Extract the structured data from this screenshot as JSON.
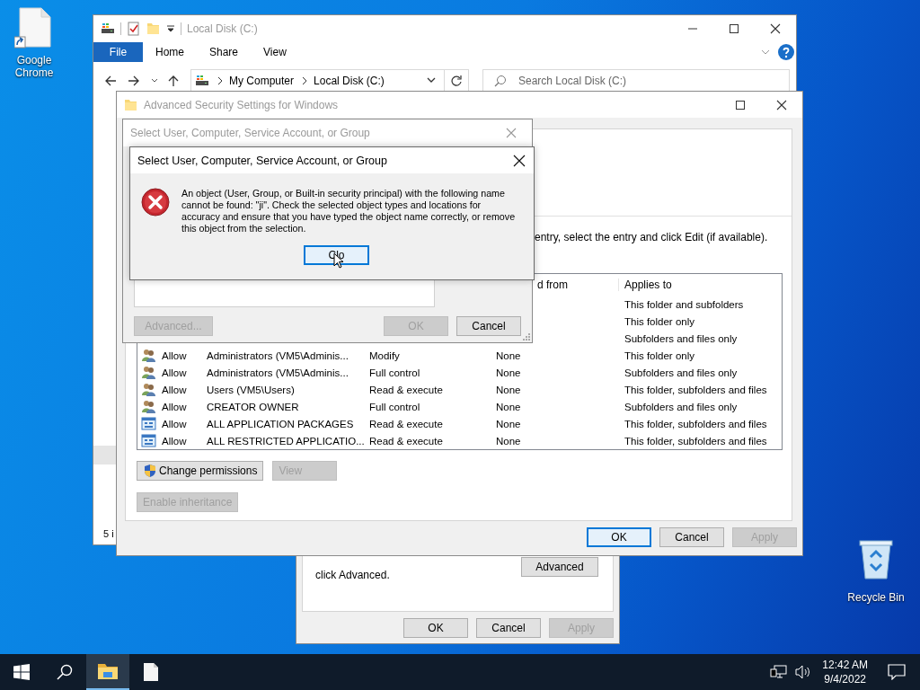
{
  "desktop_icons": [
    {
      "label": "Google Chrome",
      "kind": "shortcut"
    },
    {
      "label": "Recycle Bin",
      "kind": "recycle"
    }
  ],
  "explorer": {
    "title": "Local Disk (C:)",
    "ribbon_tabs": [
      {
        "label": "File",
        "kind": "menu"
      },
      {
        "label": "Home",
        "kind": "tab"
      },
      {
        "label": "Share",
        "kind": "tab"
      },
      {
        "label": "View",
        "kind": "tab"
      }
    ],
    "path": [
      "My Computer",
      "Local Disk (C:)"
    ],
    "search": {
      "placeholder": "Search Local Disk (C:)"
    },
    "status": "5 i"
  },
  "advanced_security": {
    "title": "Advanced Security Settings for Windows",
    "instruction": "entry, select the entry and click Edit (if available).",
    "columns": [
      "d from",
      "Applies to"
    ],
    "rows": [
      {
        "applies_to": "This folder and subfolders"
      },
      {
        "applies_to": "This folder only"
      },
      {
        "applies_to": "Subfolders and files only"
      },
      {
        "kind": "group",
        "type": "Allow",
        "principal": "Administrators (VM5\\Adminis...",
        "access": "Modify",
        "inherited": "None",
        "applies_to": "This folder only"
      },
      {
        "kind": "group",
        "type": "Allow",
        "principal": "Administrators (VM5\\Adminis...",
        "access": "Full control",
        "inherited": "None",
        "applies_to": "Subfolders and files only"
      },
      {
        "kind": "group",
        "type": "Allow",
        "principal": "Users (VM5\\Users)",
        "access": "Read & execute",
        "inherited": "None",
        "applies_to": "This folder, subfolders and files"
      },
      {
        "kind": "group",
        "type": "Allow",
        "principal": "CREATOR OWNER",
        "access": "Full control",
        "inherited": "None",
        "applies_to": "Subfolders and files only"
      },
      {
        "kind": "package",
        "type": "Allow",
        "principal": "ALL APPLICATION PACKAGES",
        "access": "Read & execute",
        "inherited": "None",
        "applies_to": "This folder, subfolders and files"
      },
      {
        "kind": "package",
        "type": "Allow",
        "principal": "ALL RESTRICTED APPLICATIO...",
        "access": "Read & execute",
        "inherited": "None",
        "applies_to": "This folder, subfolders and files"
      }
    ],
    "actions": [
      {
        "label": "Change permissions",
        "shield": true,
        "disabled": false
      },
      {
        "label": "View",
        "shield": false,
        "disabled": true
      }
    ],
    "inheritance_button": {
      "label": "Enable inheritance",
      "disabled": true
    },
    "buttons": [
      {
        "label": "OK",
        "default": true,
        "disabled": false
      },
      {
        "label": "Cancel",
        "default": false,
        "disabled": false
      },
      {
        "label": "Apply",
        "default": false,
        "disabled": true
      }
    ]
  },
  "properties": {
    "note": "click Advanced.",
    "advanced_button": "Advanced",
    "buttons": [
      {
        "label": "OK",
        "default": false,
        "disabled": false
      },
      {
        "label": "Cancel",
        "default": false,
        "disabled": false
      },
      {
        "label": "Apply",
        "default": false,
        "disabled": true
      }
    ]
  },
  "select_dialog": {
    "title": "Select User, Computer, Service Account, or Group",
    "advanced_button": {
      "label": "Advanced...",
      "disabled": true
    },
    "buttons": [
      {
        "label": "OK",
        "default": false,
        "disabled": true
      },
      {
        "label": "Cancel",
        "default": false,
        "disabled": false
      }
    ]
  },
  "error_dialog": {
    "title": "Select User, Computer, Service Account, or Group",
    "message": "An object (User, Group, or Built-in security principal) with the following name cannot be found: \"ji\". Check the selected object types and locations for accuracy and ensure that you have typed the object name correctly, or remove this object from the selection.",
    "button": "Clo"
  },
  "taskbar": {
    "apps": [
      {
        "kind": "explorer",
        "active": true
      },
      {
        "kind": "document",
        "active": false
      }
    ],
    "time": "12:42 AM",
    "date": "9/4/2022"
  }
}
